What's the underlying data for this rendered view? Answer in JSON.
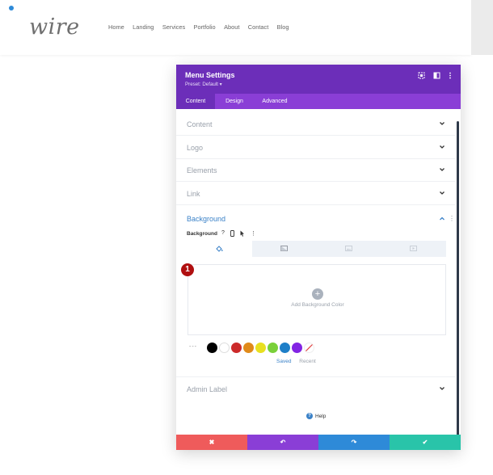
{
  "site": {
    "logo": "wire",
    "nav": [
      "Home",
      "Landing",
      "Services",
      "Portfolio",
      "About",
      "Contact",
      "Blog"
    ]
  },
  "modal": {
    "title": "Menu Settings",
    "preset": "Preset: Default ▾",
    "tabs": [
      "Content",
      "Design",
      "Advanced"
    ],
    "active_tab": "Content",
    "sections": [
      "Content",
      "Logo",
      "Elements",
      "Link"
    ],
    "background": {
      "title": "Background",
      "label": "Background",
      "add_label": "Add Background Color",
      "step_number": "1",
      "swatches": [
        "#000000",
        "#ffffff",
        "#cc2a2a",
        "#e08a1a",
        "#e8e020",
        "#7ad03a",
        "#1e7fc8",
        "#8224e3"
      ],
      "saved": "Saved",
      "recent": "Recent",
      "dash": "---"
    },
    "admin_label": "Admin Label",
    "help": "Help",
    "footer": {
      "cancel": "✖",
      "undo": "↶",
      "redo": "↷",
      "save": "✔"
    },
    "colors": {
      "header": "#6c2eb9",
      "tabs": "#8a3ed6",
      "cancel": "#ef5b5b",
      "undo": "#8a3ed6",
      "redo": "#2e8ad8",
      "save": "#29c4a9"
    }
  }
}
